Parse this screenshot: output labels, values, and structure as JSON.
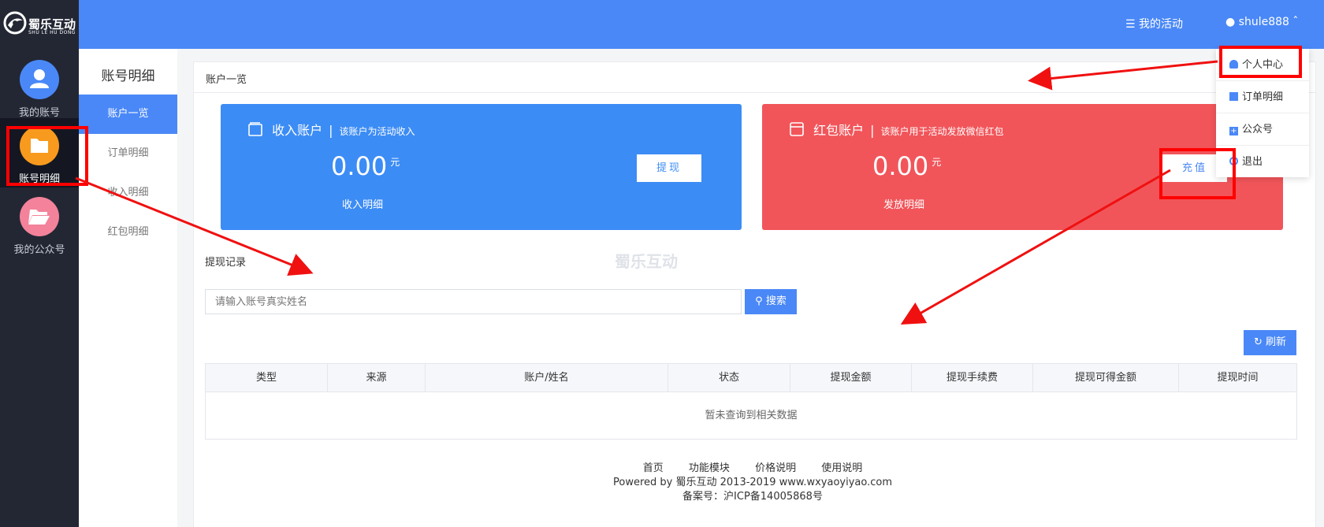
{
  "brand": {
    "name": "蜀乐互动",
    "sub": "SHU LE HU DONG"
  },
  "rail": [
    {
      "label": "我的账号",
      "color": "#4a88f7",
      "icon": "user-icon"
    },
    {
      "label": "账号明细",
      "color": "#f79a1e",
      "icon": "folder-icon",
      "active": true
    },
    {
      "label": "我的公众号",
      "color": "#f3829a",
      "icon": "folder-open-icon"
    }
  ],
  "topbar": {
    "activity": "我的活动",
    "user": "shule888"
  },
  "subnav": {
    "title": "账号明细",
    "items": [
      "账户一览",
      "订单明细",
      "收入明细",
      "红包明细"
    ]
  },
  "panel": {
    "title": "账户一览"
  },
  "income_card": {
    "title": "收入账户",
    "desc": "该账户为活动收入",
    "amount": "0.00",
    "unit": "元",
    "detail": "收入明细",
    "button": "提现",
    "color": "#3c8cf5"
  },
  "redpack_card": {
    "title": "红包账户",
    "desc": "该账户用于活动发放微信红包",
    "amount": "0.00",
    "unit": "元",
    "detail": "发放明细",
    "button": "充值",
    "color": "#f1555a"
  },
  "withdraw": {
    "section_title": "提现记录",
    "search_placeholder": "请输入账号真实姓名",
    "search_button": "搜索",
    "refresh_button": "刷新",
    "columns": [
      "类型",
      "来源",
      "账户/姓名",
      "状态",
      "提现金额",
      "提现手续费",
      "提现可得金额",
      "提现时间"
    ],
    "empty_text": "暂未查询到相关数据"
  },
  "watermark": "蜀乐互动",
  "footer": {
    "links": [
      "首页",
      "功能模块",
      "价格说明",
      "使用说明"
    ],
    "powered": "Powered by 蜀乐互动 2013-2019 www.wxyaoyiyao.com",
    "icp": "备案号：沪ICP备14005868号"
  },
  "dropdown": [
    "个人中心",
    "订单明细",
    "公众号",
    "退出"
  ]
}
